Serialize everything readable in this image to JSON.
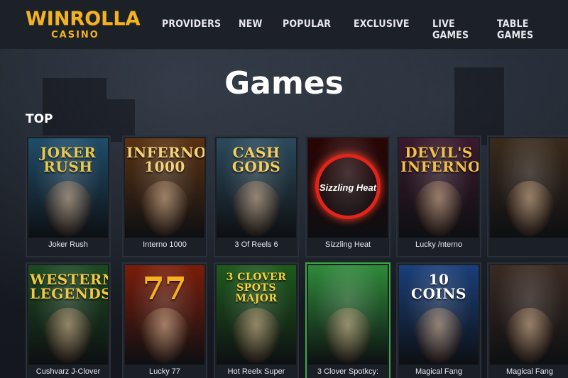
{
  "brand": {
    "name": "WINROLLA",
    "sub": "CASINO"
  },
  "nav": [
    "PROVIDERS",
    "NEW",
    "POPULAR",
    "EXCLUSIVE",
    "LIVE GAMES",
    "TABLE GAMES"
  ],
  "page_title": "Games",
  "section_title": "TOP",
  "games": [
    {
      "caption": "Joker Rush",
      "art_text": "JOKER\nRUSH",
      "art_color": "#e9c94a",
      "bg": "#1f4d6a"
    },
    {
      "caption": "Interno 1000",
      "art_text": "INFERNO\n1000",
      "art_color": "#f3d27a",
      "bg": "#5a3212"
    },
    {
      "caption": "3 Of Reels 6",
      "art_text": "CASH\nGODS",
      "art_color": "#f5cf5c",
      "bg": "#2c4a5c"
    },
    {
      "caption": "Sizzling Heat",
      "art_text": "Sizzling Heat",
      "art_color": "#ffffff",
      "bg": "#2a0505"
    },
    {
      "caption": "Lucky /nterno",
      "art_text": "DEVIL'S\nINFERNO",
      "art_color": "#f2c14a",
      "bg": "#3b1a2e"
    },
    {
      "caption": "",
      "art_text": "",
      "art_color": "#ffffff",
      "bg": "#3a2a1c"
    },
    {
      "caption": "Cushvarz J-Clover",
      "art_text": "WESTERN\nLEGENDS",
      "art_color": "#f2c745",
      "bg": "#1d4a22"
    },
    {
      "caption": "Lucky 77",
      "art_text": "77",
      "art_color": "#f7b21e",
      "bg": "#7a1d0a"
    },
    {
      "caption": "Hot Reelx Super",
      "art_text": "3 CLOVER\nSPOTS\nMAJOR",
      "art_color": "#f5d235",
      "bg": "#1f5a1d"
    },
    {
      "caption": "3 Clover Spotkcy:",
      "art_text": "",
      "art_color": "#ffffff",
      "bg": "#2f8a3a"
    },
    {
      "caption": "Magical Fang",
      "art_text": "10 COINS",
      "art_color": "#ffffff",
      "bg": "#1a3f7a"
    },
    {
      "caption": "Magical Fang",
      "art_text": "",
      "art_color": "#ffffff",
      "bg": "#3a2a22"
    }
  ]
}
